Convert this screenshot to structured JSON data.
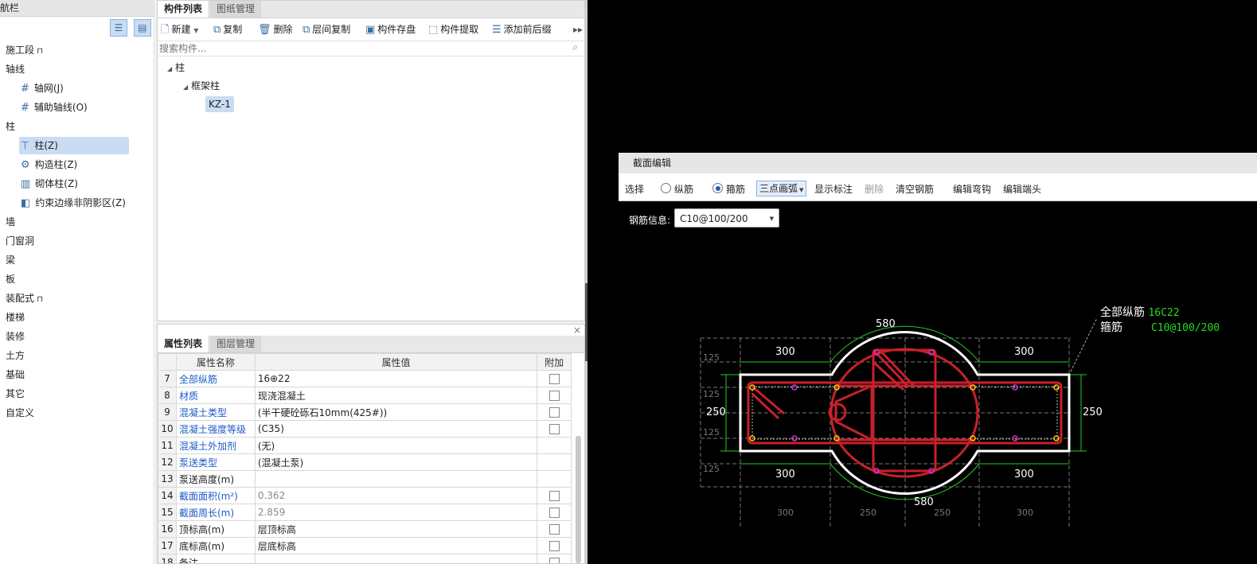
{
  "nav": {
    "title": "导航栏",
    "items": [
      {
        "label": "施工段",
        "lock": true,
        "level": 0
      },
      {
        "label": "轴线",
        "level": 0
      },
      {
        "label": "轴网(J)",
        "level": 1,
        "icon": "grid-icon"
      },
      {
        "label": "辅助轴线(O)",
        "level": 1,
        "icon": "grid-icon"
      },
      {
        "label": "柱",
        "level": 0
      },
      {
        "label": "柱(Z)",
        "level": 1,
        "icon": "column-icon",
        "selected": true
      },
      {
        "label": "构造柱(Z)",
        "level": 1,
        "icon": "gear-column-icon"
      },
      {
        "label": "砌体柱(Z)",
        "level": 1,
        "icon": "brick-column-icon"
      },
      {
        "label": "约束边缘非阴影区(Z)",
        "level": 1,
        "icon": "edge-zone-icon"
      },
      {
        "label": "墙",
        "level": 0
      },
      {
        "label": "门窗洞",
        "level": 0
      },
      {
        "label": "梁",
        "level": 0
      },
      {
        "label": "板",
        "level": 0
      },
      {
        "label": "装配式",
        "lock": true,
        "level": 0
      },
      {
        "label": "楼梯",
        "level": 0
      },
      {
        "label": "装修",
        "level": 0
      },
      {
        "label": "土方",
        "level": 0
      },
      {
        "label": "基础",
        "level": 0
      },
      {
        "label": "其它",
        "level": 0
      },
      {
        "label": "自定义",
        "level": 0
      }
    ]
  },
  "components": {
    "tabs": [
      "构件列表",
      "图纸管理"
    ],
    "toolbar": [
      "新建",
      "复制",
      "删除",
      "层间复制",
      "构件存盘",
      "构件提取",
      "添加前后缀"
    ],
    "search_placeholder": "搜索构件...",
    "tree": {
      "root": "柱",
      "child": "框架柱",
      "leaf": "KZ-1"
    }
  },
  "properties": {
    "tabs": [
      "属性列表",
      "图层管理"
    ],
    "headers": [
      "属性名称",
      "属性值",
      "附加"
    ],
    "rows": [
      {
        "n": "7",
        "name": "全部纵筋",
        "value": "16⊕22",
        "blue": true,
        "cb": true
      },
      {
        "n": "8",
        "name": "材质",
        "value": "现浇混凝土",
        "blue": true,
        "cb": true
      },
      {
        "n": "9",
        "name": "混凝土类型",
        "value": "(半干硬砼砾石10mm(425#))",
        "blue": true,
        "cb": true
      },
      {
        "n": "10",
        "name": "混凝土强度等级",
        "value": "(C35)",
        "blue": true,
        "cb": true
      },
      {
        "n": "11",
        "name": "混凝土外加剂",
        "value": "(无)",
        "blue": true,
        "cb": false
      },
      {
        "n": "12",
        "name": "泵送类型",
        "value": "(混凝土泵)",
        "blue": true,
        "cb": false
      },
      {
        "n": "13",
        "name": "泵送高度(m)",
        "value": "",
        "blue": false,
        "cb": false
      },
      {
        "n": "14",
        "name": "截面面积(m²)",
        "value": "0.362",
        "blue": true,
        "cb": true,
        "grey": true
      },
      {
        "n": "15",
        "name": "截面周长(m)",
        "value": "2.859",
        "blue": true,
        "cb": true,
        "grey": true
      },
      {
        "n": "16",
        "name": "顶标高(m)",
        "value": "层顶标高",
        "blue": false,
        "cb": true
      },
      {
        "n": "17",
        "name": "底标高(m)",
        "value": "层底标高",
        "blue": false,
        "cb": true
      },
      {
        "n": "18",
        "name": "备注",
        "value": "",
        "blue": false,
        "cb": true
      }
    ]
  },
  "section": {
    "title": "截面编辑",
    "toolbar": {
      "select": "选择",
      "longitudinal": "纵筋",
      "stirrup": "箍筋",
      "mode": "三点画弧",
      "show_dim": "显示标注",
      "delete": "删除",
      "clear": "清空钢筋",
      "edit_hook": "编辑弯钩",
      "edit_end": "编辑端头"
    },
    "rebar_label": "钢筋信息:",
    "rebar_value": "C10@100/200",
    "info": {
      "all_label": "全部纵筋",
      "all_value": "16C22",
      "stirrup_label": "箍筋",
      "stirrup_value": "C10@100/200"
    },
    "dims": {
      "arc_top": "580",
      "arc_bottom": "580",
      "left_top": "300",
      "right_top": "300",
      "left_bottom": "300",
      "right_bottom": "300",
      "height_left": "250",
      "height_right": "250",
      "small_1": "125",
      "small_2": "125",
      "small_3": "125",
      "small_4": "125",
      "b1": "300",
      "b2": "250",
      "b3": "250",
      "b4": "300"
    }
  },
  "colors": {
    "rebar": "#c8202a",
    "dim": "#22cc22",
    "outline": "#ffffff",
    "accent": "#1e5bc6"
  }
}
